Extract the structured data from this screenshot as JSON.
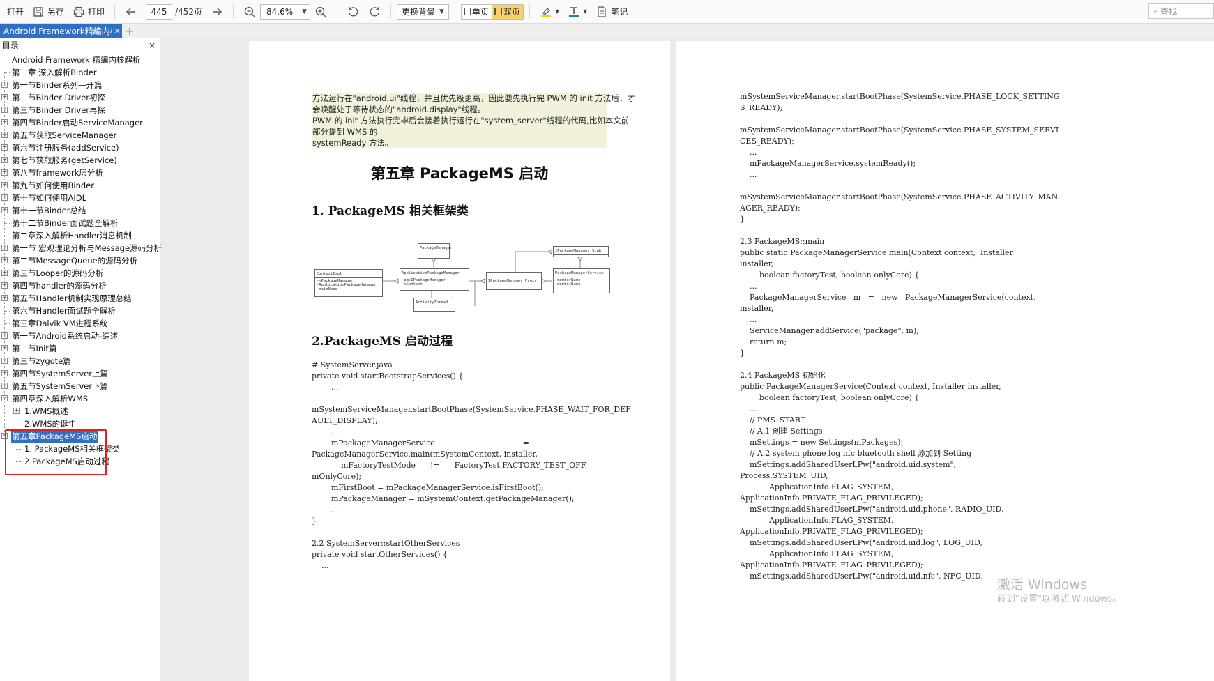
{
  "toolbar": {
    "open": "打开",
    "save_as": "另存",
    "print": "打印",
    "current_page": "445",
    "total_pages": "/452页",
    "zoom": "84.6%",
    "background": "更换背景",
    "single_page": "单页",
    "double_page": "双页",
    "notes": "笔记",
    "search_placeholder": "查找"
  },
  "tab": {
    "title": "Android Framework精编内核解析",
    "close": "×",
    "add": "+"
  },
  "sidebar": {
    "title": "目录",
    "close": "×",
    "items": [
      "Android Framework 精编内核解析",
      "第一章 深入解析Binder",
      "第一节Binder系列—开篇",
      "第二节Binder Driver初探",
      "第三节Binder Driver再探",
      "第四节Binder启动ServiceManager",
      "第五节获取ServiceManager",
      "第六节注册服务(addService)",
      "第七节获取服务(getService)",
      "第八节framework层分析",
      "第九节如何使用Binder",
      "第十节如何使用AIDL",
      "第十一节Binder总结",
      "第十二节Binder面试题全解析",
      "第二章深入解析Handler消息机制",
      "第一节 宏观理论分析与Message源码分析",
      "第二节MessageQueue的源码分析",
      "第三节Looper的源码分析",
      "第四节handler的源码分析",
      "第五节Handler机制实现原理总结",
      "第六节Handler面试题全解析",
      "第三章Dalvik VM进程系统",
      "第一节Android系统启动-综述",
      "第二节Init篇",
      "第三节zygote篇",
      "第四节SystemServer上篇",
      "第五节SystemServer下篇",
      "第四章深入解析WMS",
      "1.WMS概述",
      "2.WMS的诞生",
      "第五章PackageMS启动",
      "1. PackageMS相关框架类",
      "2.PackageMS启动过程"
    ]
  },
  "left_page": {
    "highlight_lines": [
      "方法运行在\"android.ui\"线程，并且优先级更高，因此要先执行完 PWM 的 init 方法后，才",
      "会唤醒处于等待状态的\"android.display\"线程。",
      "PWM 的 init 方法执行完毕后会接着执行运行在\"system_server\"线程的代码,比如本文前",
      "部分提到 WMS 的",
      "systemReady 方法。"
    ],
    "chapter_title": "第五章 PackageMS 启动",
    "section1": "1.  PackageMS 相关框架类",
    "section2": "2.PackageMS 启动过程",
    "diagram": {
      "package_manager": "PackageManager",
      "ipackage_manager_stub": "IPackageManager.Stub",
      "context_impl": "ContextImpl",
      "context_impl_f1": "-mPackageManager",
      "context_impl_f2": "-ApplicationPackageManager",
      "context_impl_f3": "-mainName",
      "app_package_manager": "ApplicationPackageManager",
      "app_package_manager_f1": "-pm:IPackageManager",
      "app_package_manager_f2": "-mContext",
      "ipm_proxy": "IPackageManager.Proxy",
      "pms": "PackageManagerService",
      "pms_f1": "-memberName",
      "pms_f2": "-memberName",
      "activity_thread": "ActivityThread"
    },
    "code": [
      "# SystemServer.java",
      "private void startBootstrapServices() {",
      "        ...",
      "",
      "mSystemServiceManager.startBootPhase(SystemService.PHASE_WAIT_FOR_DEF",
      "AULT_DISPLAY);",
      "        ...",
      "        mPackageManagerService                                    =",
      "PackageManagerService.main(mSystemContext, installer,",
      "            mFactoryTestMode      !=      FactoryTest.FACTORY_TEST_OFF,",
      "mOnlyCore);",
      "        mFirstBoot = mPackageManagerService.isFirstBoot();",
      "        mPackageManager = mSystemContext.getPackageManager();",
      "        ...",
      "}",
      "",
      "2.2 SystemServer::startOtherServices",
      "private void startOtherServices() {",
      "    ..."
    ]
  },
  "right_page": {
    "code": [
      "mSystemServiceManager.startBootPhase(SystemService.PHASE_LOCK_SETTING",
      "S_READY);",
      "",
      "mSystemServiceManager.startBootPhase(SystemService.PHASE_SYSTEM_SERVI",
      "CES_READY);",
      "    ...",
      "    mPackageManagerService.systemReady();",
      "    ...",
      "",
      "mSystemServiceManager.startBootPhase(SystemService.PHASE_ACTIVITY_MAN",
      "AGER_READY);",
      "}",
      "",
      "2.3 PackageMS::main",
      "public static PackageManagerService main(Context context,  Installer",
      "installer,",
      "        boolean factoryTest, boolean onlyCore) {",
      "    ...",
      "    PackageManagerService   m   =   new   PackageManagerService(context,",
      "installer,",
      "    ...",
      "    ServiceManager.addService(\"package\", m);",
      "    return m;",
      "}",
      "",
      "2.4 PackageMS 初始化",
      "public PackageManagerService(Context context, Installer installer,",
      "        boolean factoryTest, boolean onlyCore) {",
      "    ...",
      "    // PMS_START",
      "    // A.1 创建 Settings",
      "    mSettings = new Settings(mPackages);",
      "    // A.2 system phone log nfc bluetooth shell 添加到 Setting",
      "    mSettings.addSharedUserLPw(\"android.uid.system\",",
      "Process.SYSTEM_UID,",
      "            ApplicationInfo.FLAG_SYSTEM,",
      "ApplicationInfo.PRIVATE_FLAG_PRIVILEGED);",
      "    mSettings.addSharedUserLPw(\"android.uid.phone\", RADIO_UID,",
      "            ApplicationInfo.FLAG_SYSTEM,",
      "ApplicationInfo.PRIVATE_FLAG_PRIVILEGED);",
      "    mSettings.addSharedUserLPw(\"android.uid.log\", LOG_UID,",
      "            ApplicationInfo.FLAG_SYSTEM,",
      "ApplicationInfo.PRIVATE_FLAG_PRIVILEGED);",
      "    mSettings.addSharedUserLPw(\"android.uid.nfc\", NFC_UID,"
    ]
  },
  "watermark": {
    "line1": "激活 Windows",
    "line2": "转到\"设置\"以激活 Windows。"
  },
  "colors": {
    "accent": "#2f6fc4",
    "selection_box": "#e02020",
    "highlight": "#f2f2dc",
    "active_view": "#f7d26a"
  }
}
